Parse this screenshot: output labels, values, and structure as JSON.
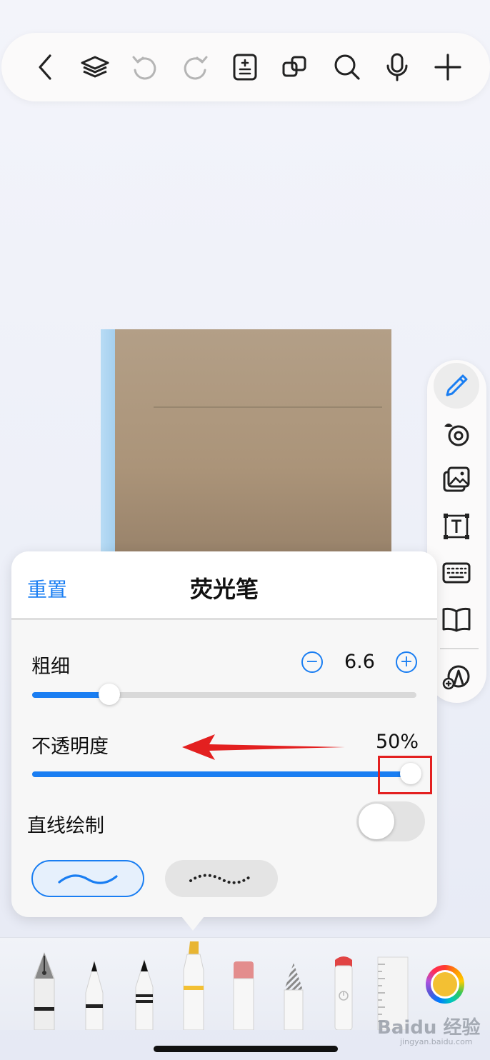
{
  "toolbar": {
    "icons": [
      "back-icon",
      "layers-icon",
      "undo-icon",
      "redo-icon",
      "page-adjust-icon",
      "duplicate-icon",
      "search-icon",
      "microphone-icon",
      "add-icon"
    ]
  },
  "side_toolbar": {
    "icons": [
      "pen-icon",
      "lasso-icon",
      "image-icon",
      "text-box-icon",
      "keyboard-icon",
      "book-icon",
      "shapes-icon"
    ],
    "active": "pen-icon"
  },
  "panel": {
    "reset_label": "重置",
    "title": "荧光笔",
    "thickness": {
      "label": "粗细",
      "value": "6.6",
      "slider_fraction": 0.2
    },
    "opacity": {
      "label": "不透明度",
      "value": "50%",
      "slider_fraction": 0.985
    },
    "straight_line": {
      "label": "直线绘制",
      "enabled": false
    },
    "stroke_styles": [
      "solid-wave",
      "dotted-wave"
    ],
    "selected_style": "solid-wave"
  },
  "tray": {
    "tools": [
      "fountain-pen",
      "ballpoint-pen",
      "pencil",
      "highlighter",
      "eraser",
      "pattern-pen",
      "marker",
      "ruler"
    ],
    "selected_color": "#f3c033"
  },
  "watermark": {
    "main": "Baidu 经验",
    "sub": "jingyan.baidu.com"
  },
  "colors": {
    "accent": "#1a7ef2",
    "annotation": "#e32020",
    "highlighter": "#f3c033"
  }
}
